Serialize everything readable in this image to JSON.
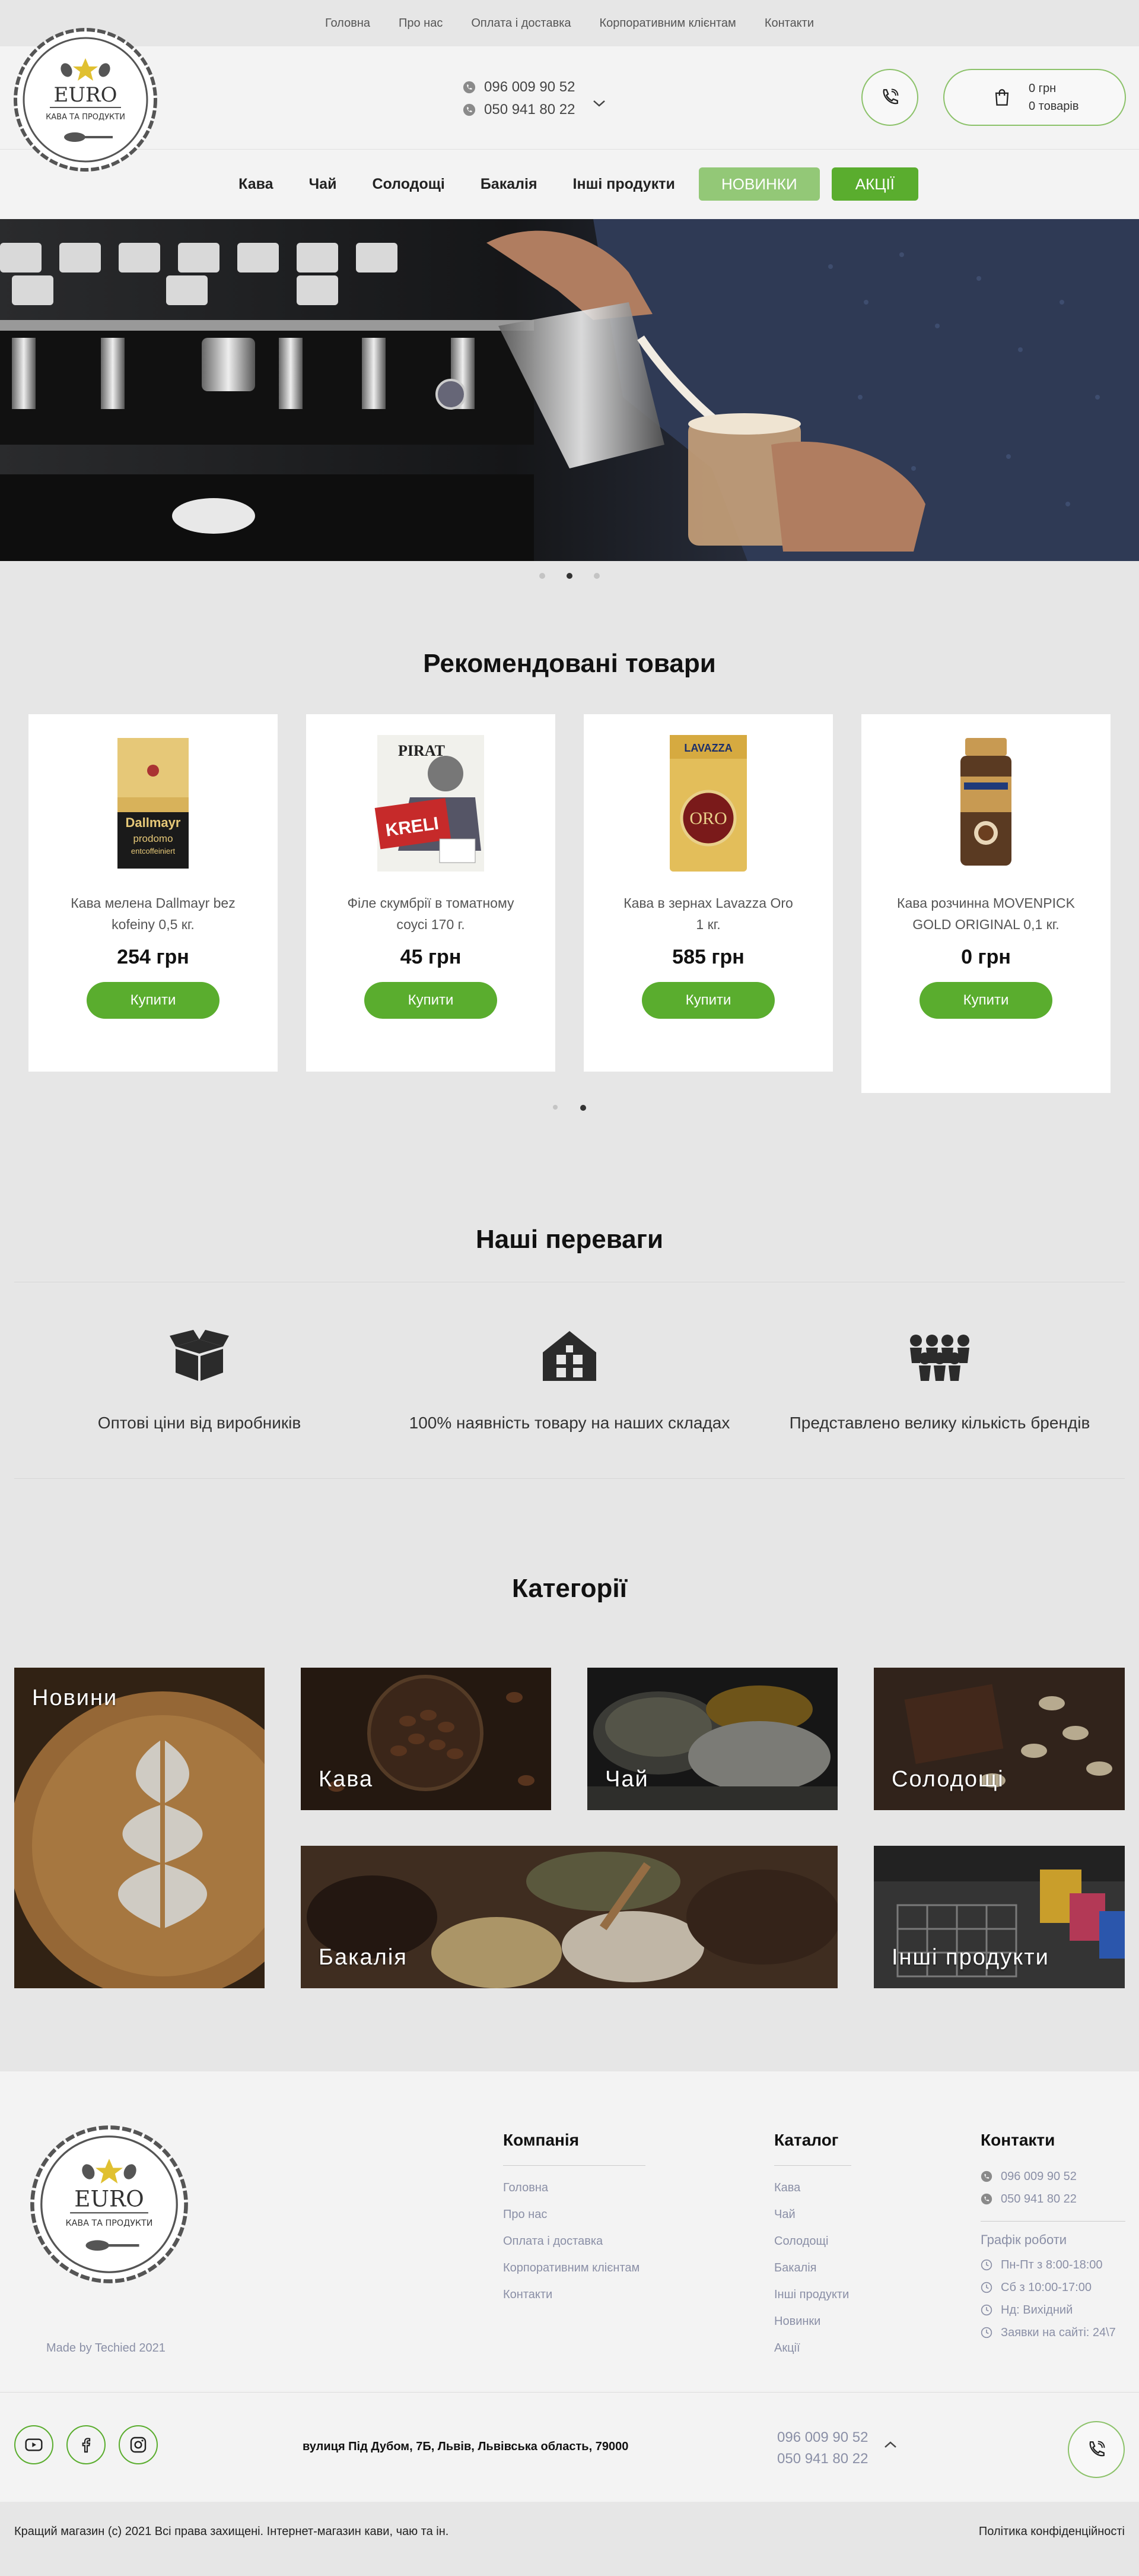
{
  "topnav": [
    "Головна",
    "Про нас",
    "Оплата і доставка",
    "Корпоративним клієнтам",
    "Контакти"
  ],
  "logo": {
    "name": "EURO",
    "tagline": "КАВА ТА ПРОДУКТИ"
  },
  "header": {
    "phones": [
      "096 009 90 52",
      "050 941 80 22"
    ],
    "cart_sum": "0 грн",
    "cart_count": "0 товарів"
  },
  "nav": {
    "items": [
      "Кава",
      "Чай",
      "Солодощі",
      "Бакалія",
      "Інші продукти"
    ],
    "new_label": "НОВИНКИ",
    "sale_label": "АКЦІЇ"
  },
  "recommended": {
    "title": "Рекомендовані товари",
    "products": [
      {
        "name": "Кава мелена Dallmayr bez kofeiny 0,5 кг.",
        "price": "254 грн",
        "buy": "Купити"
      },
      {
        "name": "Філе скумбрії в томатному соусі 170 г.",
        "price": "45 грн",
        "buy": "Купити"
      },
      {
        "name": "Кава в зернах Lavazza Oro 1 кг.",
        "price": "585 грн",
        "buy": "Купити"
      },
      {
        "name": "Кава розчинна MOVENPICK GOLD ORIGINAL 0,1 кг.",
        "price": "0 грн",
        "buy": "Купити"
      }
    ],
    "package_labels": {
      "dallmayr": "Dallmayr",
      "dallmayr_sub": "prodomo",
      "dallmayr_sub2": "entcoffeiniert",
      "pirat": "PIRAT",
      "pirat_sub": "KRELI",
      "lavazza": "LAVAZZA",
      "lavazza_sub": "ORO"
    }
  },
  "advantages": {
    "title": "Наші переваги",
    "items": [
      {
        "label": "Оптові ціни від виробників",
        "icon": "box-icon"
      },
      {
        "label": "100% наявність товару на наших складах",
        "icon": "warehouse-icon"
      },
      {
        "label": "Представлено велику кількість брендів",
        "icon": "brands-icon"
      }
    ]
  },
  "categories": {
    "title": "Категорії",
    "items": [
      "Новини",
      "Кава",
      "Чай",
      "Солодощі",
      "Бакалія",
      "Інші продукти"
    ]
  },
  "footer": {
    "made_by": "Made by Techied 2021",
    "company": {
      "title": "Компанія",
      "links": [
        "Головна",
        "Про нас",
        "Оплата і доставка",
        "Корпоративним клієнтам",
        "Контакти"
      ]
    },
    "catalog": {
      "title": "Каталог",
      "links": [
        "Кава",
        "Чай",
        "Солодощі",
        "Бакалія",
        "Інші продукти",
        "Новинки",
        "Акції"
      ]
    },
    "contacts": {
      "title": "Контакти",
      "phones": [
        "096 009 90 52",
        "050 941 80 22"
      ],
      "schedule_title": "Графік роботи",
      "schedule": [
        "Пн-Пт з 8:00-18:00",
        "Сб з 10:00-17:00",
        "Нд: Вихідний",
        "Заявки на сайті: 24\\7"
      ]
    },
    "address": "вулиця Під Дубом, 7Б, Львів, Львівська область, 79000",
    "phones": [
      "096 009 90 52",
      "050 941 80 22"
    ],
    "copyright": "Кращий магазин (с) 2021 Всі права захищені. Інтернет-магазин кави, чаю та ін.",
    "privacy": "Політика конфіденційності"
  },
  "colors": {
    "accent": "#5aad2e",
    "accent_light": "#93c877",
    "muted_text": "#8a8fa6"
  }
}
